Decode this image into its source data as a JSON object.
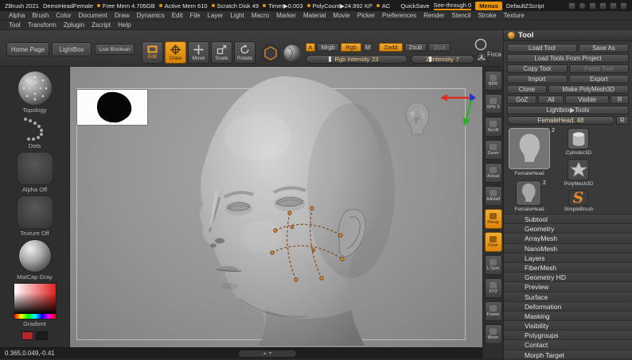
{
  "colors": {
    "accent": "#e8940f",
    "canvas_gray": "#939393",
    "panel_bg": "#3a3a3a"
  },
  "title_bar": {
    "app_title": "ZBrush 2021",
    "document_name": "DemoHeadFemale",
    "stats": [
      "Free Mem 4.705GB",
      "Active Mem 610",
      "Scratch Disk 49",
      "Timer▶0.003",
      "PolyCount▶24.992 KP",
      "AC"
    ],
    "quicksave_label": "QuickSave",
    "see_through_label": "See-through 0",
    "menus_label": "Menus",
    "zscript_label": "DefaultZScript"
  },
  "menus": {
    "row1": [
      "Alpha",
      "Brush",
      "Color",
      "Document",
      "Draw",
      "Dynamics",
      "Edit",
      "File",
      "Layer",
      "Light",
      "Macro",
      "Marker",
      "Material",
      "Movie",
      "Picker",
      "Preferences",
      "Render",
      "Stencil",
      "Stroke",
      "Texture"
    ],
    "row2": [
      "Tool",
      "Transform",
      "Zplugin",
      "Zscript",
      "Help"
    ]
  },
  "shelf": {
    "home_page": "Home Page",
    "lightbox": "LightBox",
    "live_boolean": "Live Boolean",
    "edit_label": "Edit",
    "draw_label": "Draw",
    "move_label": "Move",
    "scale_label": "Scale",
    "rotate_label": "Rotate",
    "a_label": "A",
    "mrgb_label": "Mrgb",
    "rgb_label": "Rgb",
    "m_label": "M",
    "zadd_label": "Zadd",
    "zsub_label": "Zsub",
    "zcut_label": "Zcut",
    "rgb_intensity_label": "Rgb Intensity",
    "rgb_intensity_value": "23",
    "z_intensity_label": "Z Intensity",
    "z_intensity_value": "7",
    "focal_label": "Foca"
  },
  "left_shelf": {
    "brush_label": "Topology",
    "stroke_label": "Dots",
    "alpha_label": "Alpha Off",
    "texture_label": "Texture Off",
    "material_label": "MatCap Gray",
    "color_label": "Gradient"
  },
  "canvas": {
    "coordinates": "0.365,0.049,-0.41"
  },
  "right_shelf": {
    "items": [
      {
        "label": "BPR",
        "active": false
      },
      {
        "label": "SPix 3",
        "active": false
      },
      {
        "label": "Scroll",
        "active": false
      },
      {
        "label": "Zoom",
        "active": false
      },
      {
        "label": "Actual",
        "active": false
      },
      {
        "label": "AAHalf",
        "active": false
      },
      {
        "label": "Persp",
        "active": true
      },
      {
        "label": "Floor",
        "active": true
      },
      {
        "label": "L.Sym",
        "active": false
      },
      {
        "label": "XYZ",
        "active": false
      },
      {
        "label": "Frame",
        "active": false
      },
      {
        "label": "Move",
        "active": false
      }
    ]
  },
  "tool_panel": {
    "title": "Tool",
    "buttons": {
      "load_tool": "Load Tool",
      "save_as": "Save As",
      "load_tools_from_project": "Load Tools From Project",
      "copy_tool": "Copy Tool",
      "paste_tool": "Paste Tool",
      "import": "Import",
      "export": "Export",
      "clone": "Clone",
      "make_polymesh3d": "Make PolyMesh3D",
      "goz": "GoZ",
      "all": "All",
      "visible": "Visible",
      "r": "R",
      "lightbox_tools": "Lightbox▶Tools"
    },
    "active_tool": {
      "name": "FemaleHead. 48",
      "r_label": "R"
    },
    "thumbnails": [
      {
        "label": "FemaleHead",
        "badge": "2"
      },
      {
        "label": "Cylinder3D"
      },
      {
        "label": "FemaleHead",
        "badge": "2"
      },
      {
        "label": "PolyMesh3D"
      },
      {
        "label": "SimpleBrush",
        "glyph": "S"
      }
    ],
    "sections": [
      "Subtool",
      "Geometry",
      "ArrayMesh",
      "NanoMesh",
      "Layers",
      "FiberMesh",
      "Geometry HD",
      "Preview",
      "Surface",
      "Deformation",
      "Masking",
      "Visibility",
      "Polygroups",
      "Contact",
      "Morph Target"
    ]
  }
}
